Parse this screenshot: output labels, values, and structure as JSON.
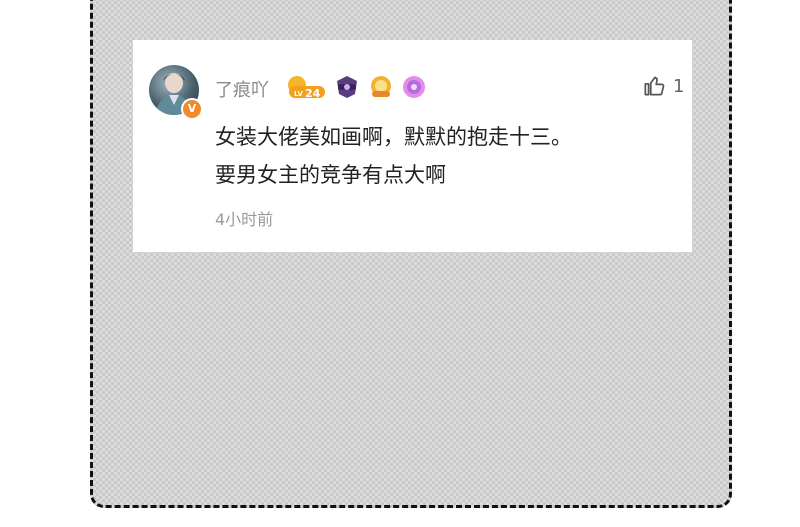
{
  "comment": {
    "username": "了痕吖",
    "avatar_badge": "V",
    "level_badge": "LV24",
    "like_icon": "thumbs-up-icon",
    "like_count": "1",
    "content_line1": "女装大佬美如画啊，默默的抱走十三。",
    "content_line2": "要男女主的竞争有点大啊",
    "time": "4小时前"
  },
  "colors": {
    "verified_badge": "#f08a2b",
    "level_badge": "#f3a020",
    "username": "#8a8a8a",
    "text": "#222222",
    "timestamp": "#9a9a9a"
  }
}
